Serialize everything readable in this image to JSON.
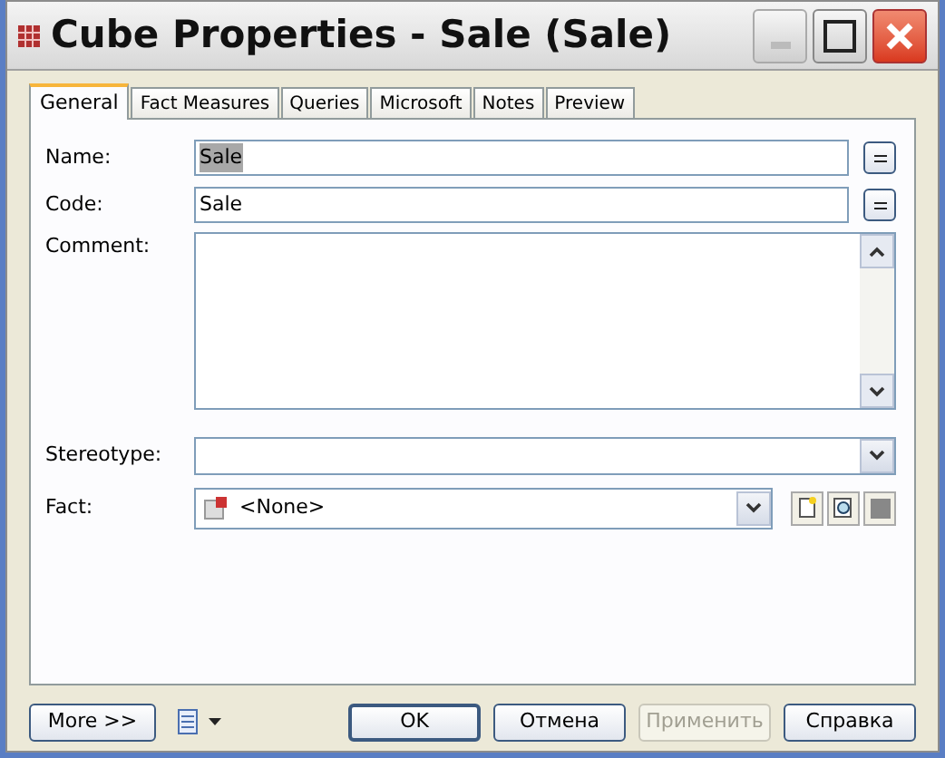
{
  "window": {
    "title": "Cube Properties - Sale (Sale)"
  },
  "tabs": [
    {
      "label": "General",
      "selected": true
    },
    {
      "label": "Fact Measures",
      "selected": false
    },
    {
      "label": "Queries",
      "selected": false
    },
    {
      "label": "Microsoft",
      "selected": false
    },
    {
      "label": "Notes",
      "selected": false
    },
    {
      "label": "Preview",
      "selected": false
    }
  ],
  "form": {
    "name": {
      "label": "Name:",
      "value": "Sale",
      "text_selected": true
    },
    "code": {
      "label": "Code:",
      "value": "Sale",
      "text_selected": false
    },
    "comment": {
      "label": "Comment:"
    },
    "stereotype": {
      "label": "Stereotype:"
    },
    "fact": {
      "label": "Fact:",
      "value": "<None>"
    }
  },
  "footer": {
    "more": "More >>",
    "buttons": [
      {
        "label": "OK",
        "disabled": false,
        "default": true
      },
      {
        "label": "Отмена",
        "disabled": false,
        "default": false
      },
      {
        "label": "Применить",
        "disabled": true,
        "default": false
      },
      {
        "label": "Справка",
        "disabled": false,
        "default": false
      }
    ]
  }
}
